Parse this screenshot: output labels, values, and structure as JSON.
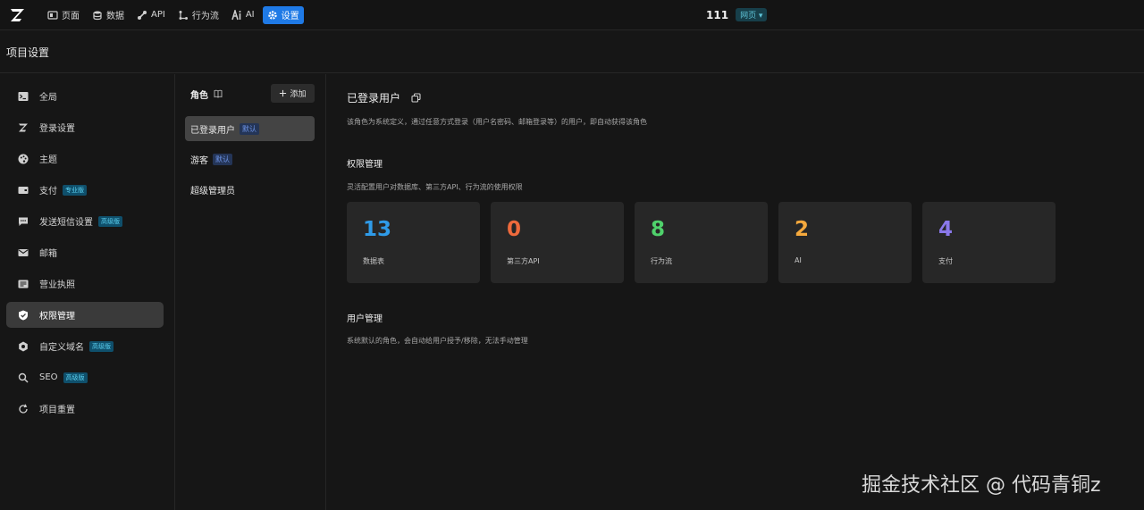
{
  "topbar": {
    "nav": [
      {
        "label": "页面",
        "icon": "page-icon"
      },
      {
        "label": "数据",
        "icon": "database-icon"
      },
      {
        "label": "API",
        "icon": "api-icon"
      },
      {
        "label": "行为流",
        "icon": "flow-icon"
      },
      {
        "label": "AI",
        "icon": "ai-icon"
      },
      {
        "label": "设置",
        "icon": "gear-icon",
        "active": true
      }
    ],
    "project_name": "111",
    "project_type": "网页 ▾"
  },
  "page": {
    "title": "项目设置"
  },
  "sidebar": {
    "items": [
      {
        "label": "全局",
        "icon": "terminal-icon",
        "tag": ""
      },
      {
        "label": "登录设置",
        "icon": "logo-z-icon",
        "tag": ""
      },
      {
        "label": "主题",
        "icon": "palette-icon",
        "tag": ""
      },
      {
        "label": "支付",
        "icon": "payment-icon",
        "tag": "专业版"
      },
      {
        "label": "发送短信设置",
        "icon": "message-icon",
        "tag": "高级版"
      },
      {
        "label": "邮箱",
        "icon": "mail-icon",
        "tag": ""
      },
      {
        "label": "营业执照",
        "icon": "license-icon",
        "tag": ""
      },
      {
        "label": "权限管理",
        "icon": "shield-icon",
        "tag": "",
        "active": true
      },
      {
        "label": "自定义域名",
        "icon": "domain-icon",
        "tag": "高级版"
      },
      {
        "label": "SEO",
        "icon": "search-icon",
        "tag": "高级版"
      },
      {
        "label": "项目重置",
        "icon": "reset-icon",
        "tag": ""
      }
    ]
  },
  "roles": {
    "title": "角色",
    "add_label": "添加",
    "items": [
      {
        "label": "已登录用户",
        "tag": "默认",
        "active": true
      },
      {
        "label": "游客",
        "tag": "默认"
      },
      {
        "label": "超级管理员",
        "tag": ""
      }
    ]
  },
  "main": {
    "title": "已登录用户",
    "description": "该角色为系统定义，通过任意方式登录（用户名密码、邮箱登录等）的用户，即自动获得该角色",
    "permissions": {
      "title": "权限管理",
      "description": "灵活配置用户对数据库、第三方API、行为流的使用权限",
      "cards": [
        {
          "value": "13",
          "label": "数据表",
          "color": "#2f9be8"
        },
        {
          "value": "0",
          "label": "第三方API",
          "color": "#ee6a3c"
        },
        {
          "value": "8",
          "label": "行为流",
          "color": "#4fd16b"
        },
        {
          "value": "2",
          "label": "AI",
          "color": "#f5a93d"
        },
        {
          "value": "4",
          "label": "支付",
          "color": "#8a78ea"
        }
      ]
    },
    "users": {
      "title": "用户管理",
      "description": "系统默认的角色，会自动给用户授予/移除，无法手动管理"
    }
  },
  "watermark": "掘金技术社区 @ 代码青铜z"
}
